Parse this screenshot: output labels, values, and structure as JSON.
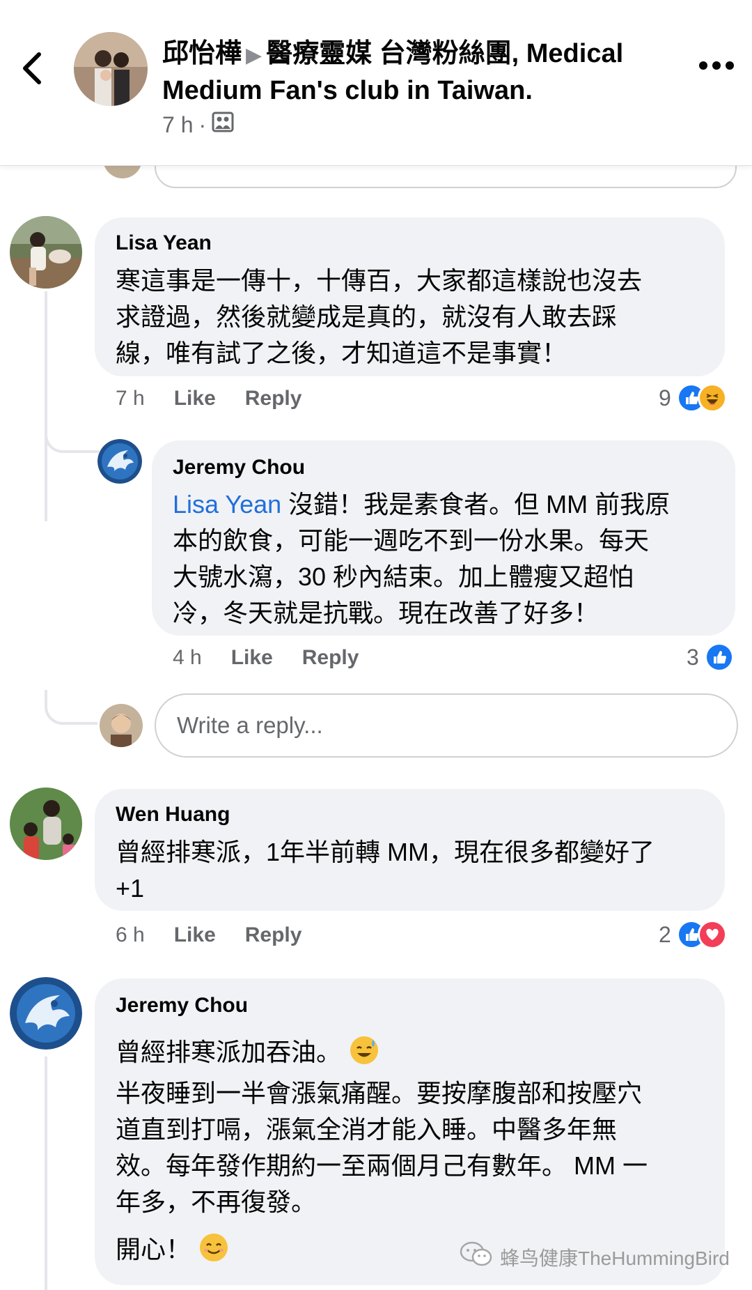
{
  "header": {
    "author": "邱怡樺",
    "group": "醫療靈媒 台灣粉絲團, Medical Medium Fan's club in Taiwan.",
    "time": "7 h",
    "separator": "·"
  },
  "comments": [
    {
      "name": "Lisa Yean",
      "text_lines": [
        "寒這事是一傳十，十傳百，大家都這樣說也沒去",
        "求證過，然後就變成是真的，就沒有人敢去踩",
        "線，唯有試了之後，才知道這不是事實！"
      ],
      "time": "7 h",
      "like": "Like",
      "reply": "Reply",
      "reaction_count": "9"
    },
    {
      "name": "Jeremy Chou",
      "mention": "Lisa Yean",
      "text_first": " 沒錯！我是素食者。但 MM 前我原",
      "text_lines": [
        "本的飲食，可能一週吃不到一份水果。每天",
        "大號水瀉，30 秒內結束。加上體瘦又超怕",
        "冷，冬天就是抗戰。現在改善了好多！"
      ],
      "time": "4 h",
      "like": "Like",
      "reply": "Reply",
      "reaction_count": "3"
    },
    {
      "name": "Wen Huang",
      "text_lines": [
        "曾經排寒派，1年半前轉 MM，現在很多都變好了",
        "+1"
      ],
      "time": "6 h",
      "like": "Like",
      "reply": "Reply",
      "reaction_count": "2"
    },
    {
      "name": "Jeremy Chou",
      "line1": "曾經排寒派加吞油。",
      "text_lines": [
        "半夜睡到一半會漲氣痛醒。要按摩腹部和按壓穴",
        "道直到打嗝，漲氣全消才能入睡。中醫多年無",
        "效。每年發作期約一至兩個月己有數年。 MM 一",
        "年多，不再復發。"
      ],
      "last_line": "開心！"
    }
  ],
  "reply_box": {
    "placeholder": "Write a reply..."
  },
  "watermark": {
    "text": "蜂鸟健康TheHummingBird"
  },
  "colors": {
    "bubble": "#f0f2f5",
    "mention": "#216fdb",
    "like_blue": "#1877f2",
    "love_red": "#f33e58",
    "haha_yellow": "#f7b125"
  }
}
